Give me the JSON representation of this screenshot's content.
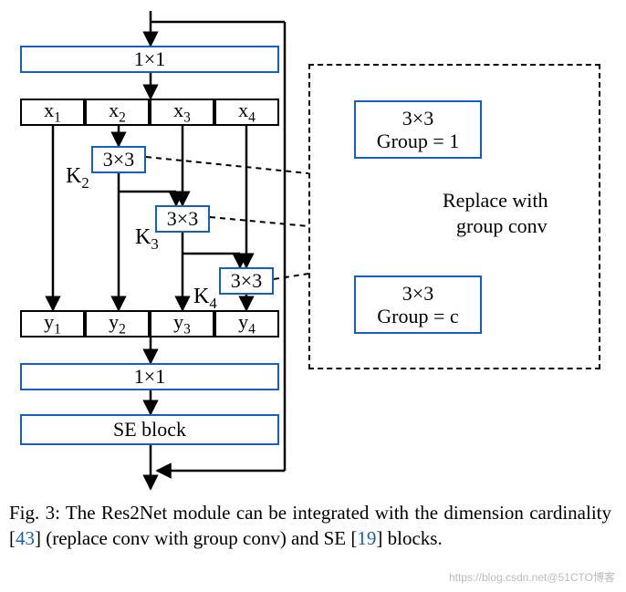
{
  "top_conv": "1×1",
  "splits": [
    "x",
    "x",
    "x",
    "x"
  ],
  "split_subs": [
    "1",
    "2",
    "3",
    "4"
  ],
  "conv33": "3×3",
  "k_labels": [
    "K",
    "K",
    "K"
  ],
  "k_subs": [
    "2",
    "3",
    "4"
  ],
  "outs": [
    "y",
    "y",
    "y",
    "y"
  ],
  "out_subs": [
    "1",
    "2",
    "3",
    "4"
  ],
  "bottom_conv": "1×1",
  "se": "SE block",
  "right": {
    "top": "3×3",
    "top2": "Group = 1",
    "edge1": "Replace with",
    "edge2": "group conv",
    "bot": "3×3",
    "bot2": "Group = c"
  },
  "caption": {
    "prefix": "Fig. 3: The Res2Net module can be integrated with the dimension cardinality [",
    "ref1": "43",
    "mid": "] (replace conv with group conv) and SE [",
    "ref2": "19",
    "suffix": "] blocks."
  },
  "watermark": "https://blog.csdn.net@51CTO博客"
}
